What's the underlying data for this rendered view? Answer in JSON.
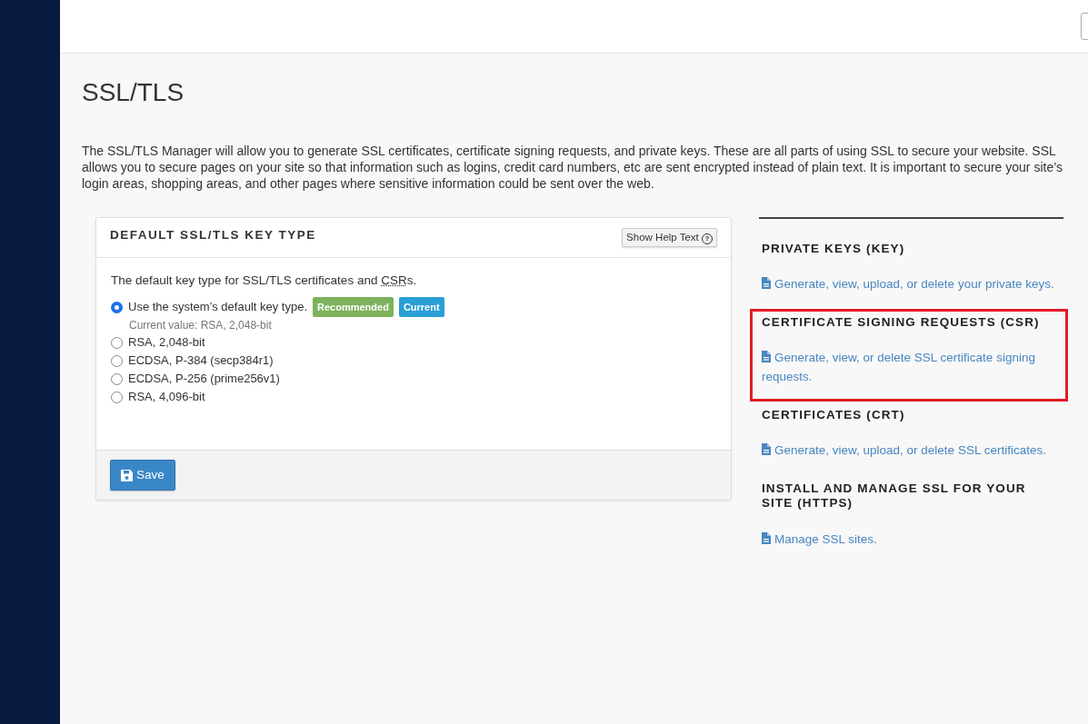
{
  "page_title": "SSL/TLS",
  "description": "The SSL/TLS Manager will allow you to generate SSL certificates, certificate signing requests, and private keys. These are all parts of using SSL to secure your website. SSL allows you to secure pages on your site so that information such as logins, credit card numbers, etc are sent encrypted instead of plain text. It is important to secure your site’s login areas, shopping areas, and other pages where sensitive information could be sent over the web.",
  "key_type_panel": {
    "title": "DEFAULT SSL/TLS KEY TYPE",
    "help_button": "Show Help Text",
    "help_icon": "?",
    "intro": {
      "before": "The default key type for SSL/TLS certificates and ",
      "abbr": "CSR",
      "after": "s."
    },
    "options": [
      {
        "label": "Use the system’s default key type.",
        "selected": true,
        "badges": [
          {
            "text": "Recommended",
            "color": "#7cb25b"
          },
          {
            "text": "Current",
            "color": "#2a9fd6"
          }
        ],
        "note": "Current value: RSA, 2,048-bit"
      },
      {
        "label": "RSA, 2,048-bit",
        "selected": false
      },
      {
        "label": "ECDSA, P-384 (secp384r1)",
        "selected": false
      },
      {
        "label": "ECDSA, P-256 (prime256v1)",
        "selected": false
      },
      {
        "label": "RSA, 4,096-bit",
        "selected": false
      }
    ],
    "save_button": "Save"
  },
  "sections": [
    {
      "heading": "PRIVATE KEYS (KEY)",
      "link": "Generate, view, upload, or delete your private keys.",
      "highlighted": false
    },
    {
      "heading": "CERTIFICATE SIGNING REQUESTS (CSR)",
      "link": "Generate, view, or delete SSL certificate signing requests.",
      "highlighted": true
    },
    {
      "heading": "CERTIFICATES (CRT)",
      "link": "Generate, view, upload, or delete SSL certificates.",
      "highlighted": false
    },
    {
      "heading": "INSTALL AND MANAGE SSL FOR YOUR SITE (HTTPS)",
      "link": "Manage SSL sites.",
      "highlighted": false
    }
  ]
}
